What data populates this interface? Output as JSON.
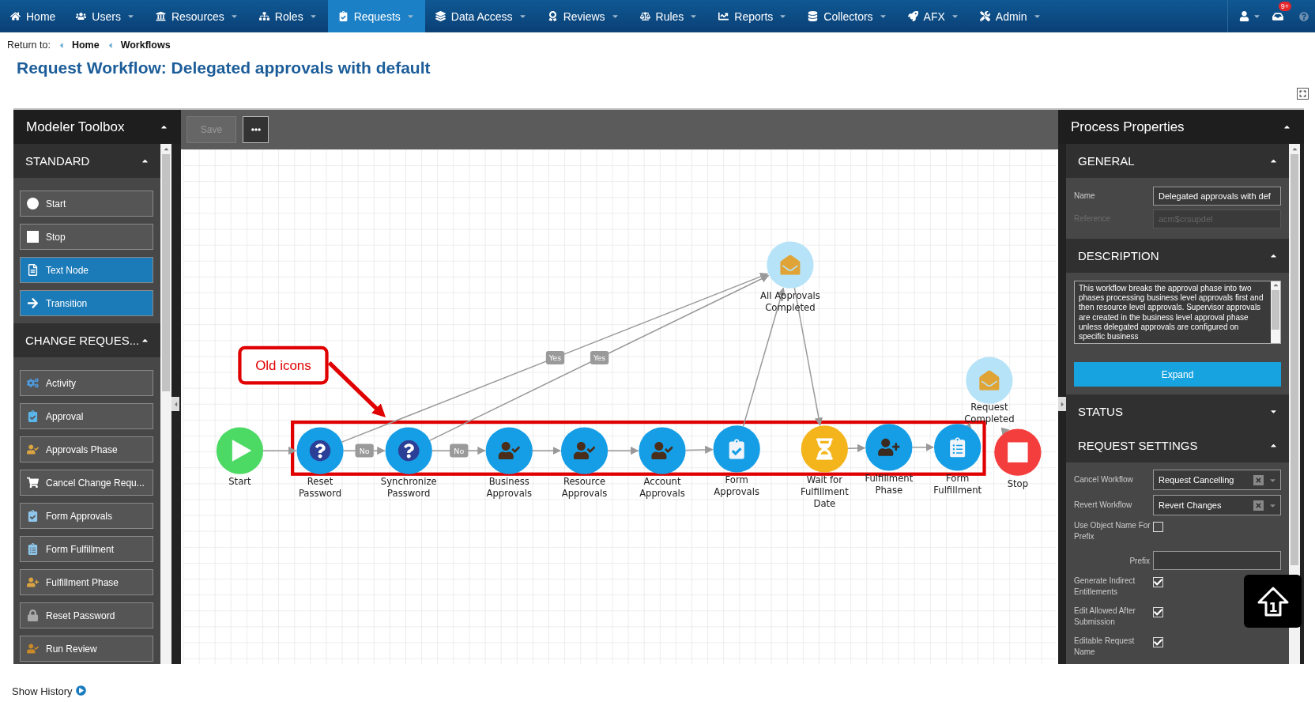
{
  "nav": {
    "items": [
      {
        "label": "Home",
        "kind": "home",
        "caret": false,
        "selected": false
      },
      {
        "label": "Users",
        "kind": "users",
        "caret": true,
        "selected": false
      },
      {
        "label": "Resources",
        "kind": "resources",
        "caret": true,
        "selected": false
      },
      {
        "label": "Roles",
        "kind": "roles",
        "caret": true,
        "selected": false
      },
      {
        "label": "Requests",
        "kind": "requests",
        "caret": true,
        "selected": true
      },
      {
        "label": "Data Access",
        "kind": "data",
        "caret": true,
        "selected": false
      },
      {
        "label": "Reviews",
        "kind": "reviews",
        "caret": true,
        "selected": false
      },
      {
        "label": "Rules",
        "kind": "rules",
        "caret": true,
        "selected": false
      },
      {
        "label": "Reports",
        "kind": "reports",
        "caret": true,
        "selected": false
      },
      {
        "label": "Collectors",
        "kind": "collectors",
        "caret": true,
        "selected": false
      },
      {
        "label": "AFX",
        "kind": "afx",
        "caret": true,
        "selected": false
      },
      {
        "label": "Admin",
        "kind": "admin",
        "caret": true,
        "selected": false
      }
    ],
    "badge": "9+"
  },
  "breadcrumb": {
    "prefix": "Return to:",
    "links": [
      "Home",
      "Workflows"
    ]
  },
  "title": "Request Workflow: Delegated approvals with default",
  "toolbox": {
    "title": "Modeler Toolbox",
    "sections": [
      {
        "title": "STANDARD",
        "expanded": true,
        "items": [
          {
            "label": "Start",
            "kind": "start",
            "highlighted": false
          },
          {
            "label": "Stop",
            "kind": "stop",
            "highlighted": false
          },
          {
            "label": "Text Node",
            "kind": "text",
            "highlighted": true
          },
          {
            "label": "Transition",
            "kind": "transition",
            "highlighted": true
          }
        ]
      },
      {
        "title": "CHANGE REQUES...",
        "expanded": true,
        "items": [
          {
            "label": "Activity",
            "kind": "activity",
            "highlighted": false
          },
          {
            "label": "Approval",
            "kind": "approval",
            "highlighted": false
          },
          {
            "label": "Approvals Phase",
            "kind": "approvals-phase",
            "highlighted": false
          },
          {
            "label": "Cancel Change Requ...",
            "kind": "cancel",
            "highlighted": false
          },
          {
            "label": "Form Approvals",
            "kind": "form-approvals",
            "highlighted": false
          },
          {
            "label": "Form Fulfillment",
            "kind": "form-fulfillment",
            "highlighted": false
          },
          {
            "label": "Fulfillment Phase",
            "kind": "fulfillment-phase",
            "highlighted": false
          },
          {
            "label": "Reset Password",
            "kind": "reset-password",
            "highlighted": false
          },
          {
            "label": "Run Review",
            "kind": "run-review",
            "highlighted": false
          }
        ]
      }
    ]
  },
  "canvas_toolbar": {
    "save": {
      "label": "Save",
      "disabled": true
    }
  },
  "diagram": {
    "nodes": [
      {
        "lines": [
          "Start"
        ],
        "kind": "start"
      },
      {
        "lines": [
          "Reset",
          "Password"
        ],
        "kind": "question"
      },
      {
        "lines": [
          "Synchronize",
          "Password"
        ],
        "kind": "question"
      },
      {
        "lines": [
          "Business",
          "Approvals"
        ],
        "kind": "approvals"
      },
      {
        "lines": [
          "Resource",
          "Approvals"
        ],
        "kind": "approvals"
      },
      {
        "lines": [
          "Account",
          "Approvals"
        ],
        "kind": "approvals"
      },
      {
        "lines": [
          "Form",
          "Approvals"
        ],
        "kind": "form-approval"
      },
      {
        "lines": [
          "Wait for",
          "Fulfillment",
          "Date"
        ],
        "kind": "wait"
      },
      {
        "lines": [
          "Fulfillment",
          "Phase"
        ],
        "kind": "fulfillment"
      },
      {
        "lines": [
          "Form",
          "Fulfillment"
        ],
        "kind": "form-fulfillment"
      },
      {
        "lines": [
          "Stop"
        ],
        "kind": "stop"
      },
      {
        "lines": [
          "All Approvals",
          "Completed"
        ],
        "kind": "event"
      },
      {
        "lines": [
          "Request",
          "Completed"
        ],
        "kind": "event"
      }
    ],
    "edge_labels": [
      "No",
      "No",
      "Yes",
      "Yes"
    ],
    "callout": "Old icons"
  },
  "properties": {
    "title": "Process Properties",
    "sections": [
      {
        "title": "GENERAL",
        "kind": "general",
        "expanded": true,
        "fields": [
          {
            "label": "Name",
            "value": "Delegated approvals with def",
            "disabled": false
          },
          {
            "label": "Reference",
            "value": "acm$crsupdel",
            "disabled": true
          }
        ]
      },
      {
        "title": "DESCRIPTION",
        "kind": "description",
        "expanded": true,
        "text": "This workflow breaks the approval phase into two phases processing business level approvals first and then resource level approvals. Supervisor approvals are created in the business level approval phase unless delegated approvals are configured on specific business",
        "button": "Expand"
      },
      {
        "title": "STATUS",
        "expanded": false
      },
      {
        "title": "REQUEST SETTINGS",
        "kind": "settings",
        "expanded": true,
        "rows": [
          {
            "kind": "select",
            "label": "Cancel Workflow",
            "value": "Request Cancelling"
          },
          {
            "kind": "select",
            "label": "Revert Workflow",
            "value": "Revert Changes"
          },
          {
            "kind": "checkbox",
            "label": "Use Object Name For Prefix",
            "checked": false
          },
          {
            "kind": "text",
            "label": "Prefix"
          },
          {
            "kind": "checkbox",
            "label": "Generate Indirect Entitlements",
            "checked": true
          },
          {
            "kind": "checkbox",
            "label": "Edit Allowed After Submission",
            "checked": true
          },
          {
            "kind": "checkbox",
            "label": "Editable Request Name",
            "checked": true
          }
        ]
      }
    ]
  },
  "scroll_top": {
    "label": "1"
  },
  "show_history": "Show History"
}
